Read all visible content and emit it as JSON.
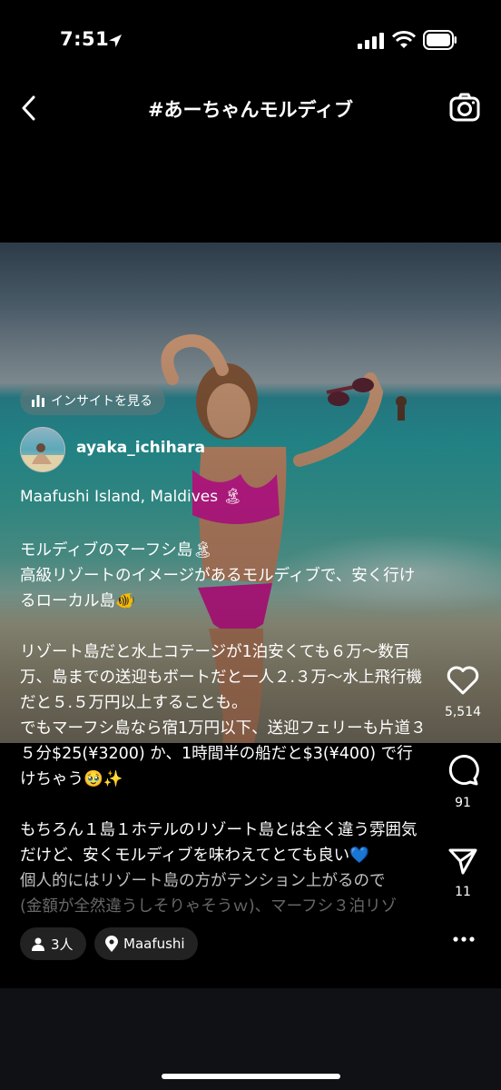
{
  "status_bar": {
    "time": "7:51"
  },
  "header": {
    "title": "#あーちゃんモルディブ",
    "back_icon": "chevron-left-icon",
    "camera_icon": "camera-icon"
  },
  "post": {
    "insight_label": "インサイトを見る",
    "username": "ayaka_ichihara",
    "location": "Maafushi Island, Maldives 🏝",
    "caption": [
      "モルディブのマーフシ島🏝",
      "高級リゾートのイメージがあるモルディブで、安く行けるローカル島🐠",
      "リゾート島だと水上コテージが1泊安くても６万〜数百万、島までの送迎もボートだと一人２.３万〜水上飛行機だと５.５万円以上することも。",
      "でもマーフシ島なら宿1万円以下、送迎フェリーも片道３５分$25(¥3200) か、1時間半の船だと$3(¥400) で行けちゃう🥹✨",
      "もちろん１島１ホテルのリゾート島とは全く違う雰囲気だけど、安くモルディブを味わえてとても良い💙",
      "個人的にはリゾート島の方がテンション上がるので",
      "(金額が全然違うしそりゃそうｗ)、マーフシ３泊リゾ"
    ]
  },
  "actions": {
    "likes": "5,514",
    "comments": "91",
    "shares": "11"
  },
  "chips": {
    "people": "3人",
    "place": "Maafushi"
  }
}
